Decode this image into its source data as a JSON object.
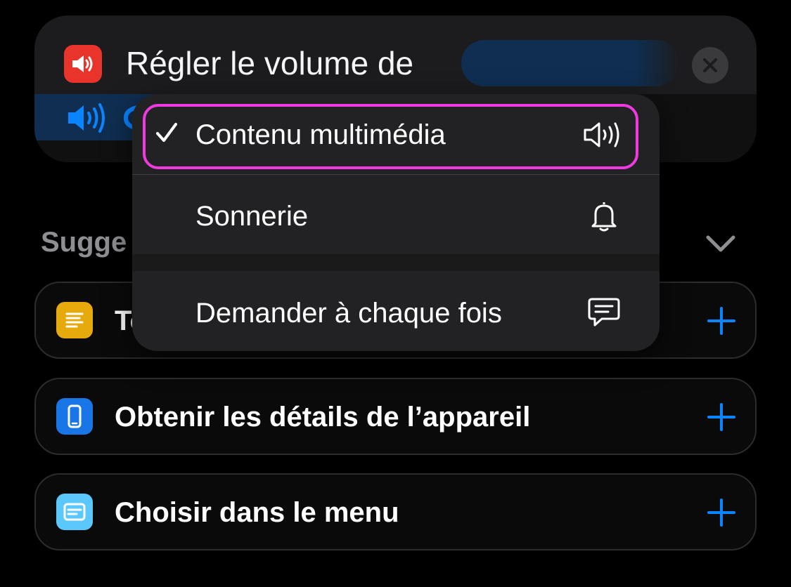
{
  "action": {
    "title": "Régler le volume de",
    "icon": "speaker-icon",
    "icon_color": "#e8342a",
    "param_color": "#0f2e51",
    "close_icon": "close-icon"
  },
  "dropdown": {
    "items": [
      {
        "label": "Contenu multimédia",
        "icon": "speaker-wave-icon",
        "selected": true
      },
      {
        "label": "Sonnerie",
        "icon": "bell-icon",
        "selected": false
      },
      {
        "label": "Demander à chaque fois",
        "icon": "speech-bubble-icon",
        "selected": false
      }
    ],
    "highlight_color": "#ef3ae0"
  },
  "suggestions": {
    "header": "Sugge",
    "collapse_icon": "chevron-down-icon",
    "items": [
      {
        "label": "To",
        "icon": "text-lines-icon",
        "icon_color": "#e6aa0c"
      },
      {
        "label": "Obtenir les détails de l’appareil",
        "icon": "phone-icon",
        "icon_color": "#1976e6"
      },
      {
        "label": "Choisir dans le menu",
        "icon": "menu-card-icon",
        "icon_color": "#5ac8fa"
      }
    ],
    "add_icon": "plus-icon",
    "accent": "#0a84ff"
  }
}
